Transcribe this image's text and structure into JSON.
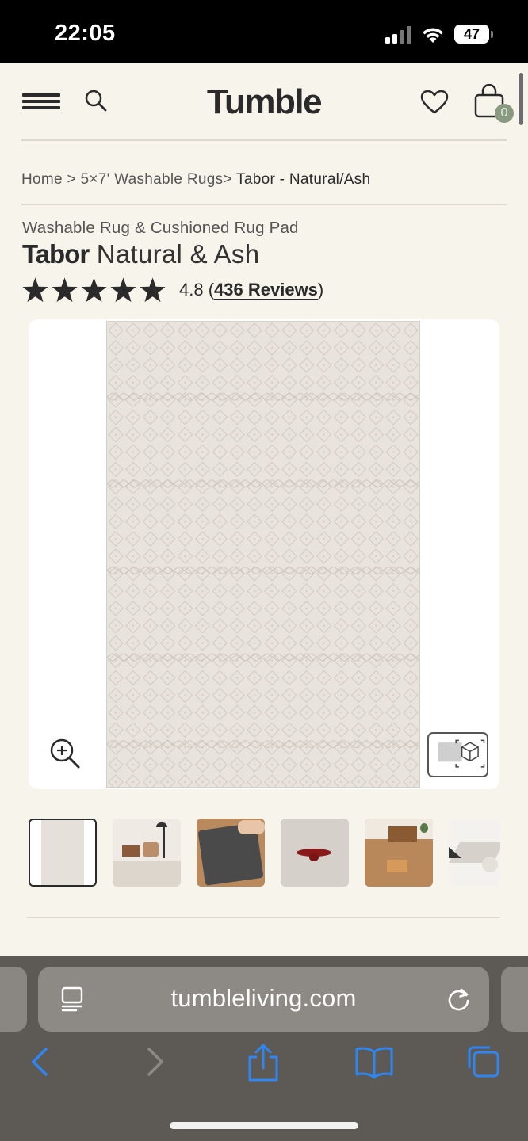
{
  "status_bar": {
    "time": "22:05",
    "battery": "47"
  },
  "header": {
    "logo": "Tumble",
    "cart_count": "0"
  },
  "breadcrumb": {
    "home": "Home",
    "sep1": " > ",
    "category": "5×7' Washable Rugs",
    "sep2": "> ",
    "current": "Tabor - Natural/Ash"
  },
  "product": {
    "subtitle": "Washable Rug & Cushioned Rug Pad",
    "name": "Tabor",
    "variant": "Natural & Ash",
    "rating": "4.8",
    "reviews_link": "436 Reviews",
    "stars": 5
  },
  "browser": {
    "url": "tumbleliving.com"
  },
  "colors": {
    "background": "#f7f4ec",
    "text": "#2a2a2a",
    "badge": "#8a9a80",
    "toolbar": "#5d5955",
    "ios_blue": "#2f86f0"
  },
  "icons": [
    "menu-icon",
    "search-icon",
    "heart-icon",
    "bag-icon",
    "star-icon",
    "zoom-in-icon",
    "ar-cube-icon",
    "reader-icon",
    "reload-icon",
    "back-icon",
    "forward-icon",
    "share-icon",
    "bookmarks-icon",
    "tabs-icon"
  ]
}
